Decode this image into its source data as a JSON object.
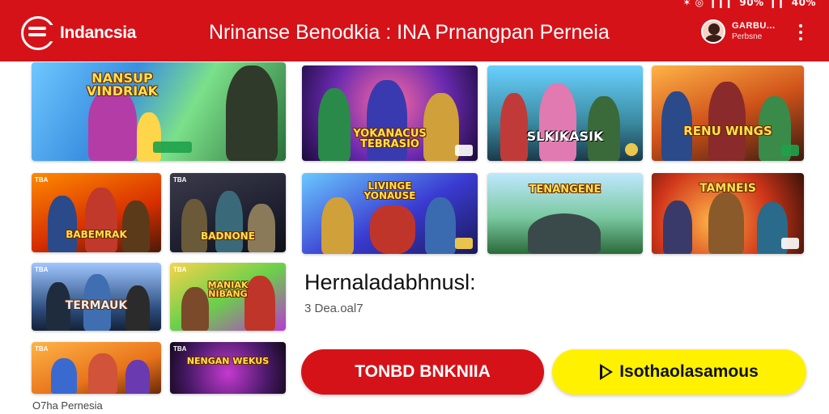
{
  "status_bar": {
    "icons": "✶ ◎",
    "signal": "▎▎▎ 90%",
    "battery": "▎▎ 40%"
  },
  "header": {
    "logo_text": "Indancsia",
    "title": "Nrinanse Benodkia : INA Prnangpan Perneia",
    "user_name": "GARBU...",
    "user_sub": "Perbsne"
  },
  "games": [
    {
      "caption": "NANSUP VINDRIAK",
      "tag": ""
    },
    {
      "caption": "YOKANACUS TEBRASIO",
      "tag": ""
    },
    {
      "caption": "SLKIKASIK",
      "tag": ""
    },
    {
      "caption": "RENU WINGS",
      "tag": ""
    },
    {
      "caption": "BABEMRAK",
      "tag": "TBA"
    },
    {
      "caption": "BADNONE",
      "tag": "TBA"
    },
    {
      "caption": "LIVINGE YONAUSE",
      "tag": ""
    },
    {
      "caption": "TENANGENE",
      "tag": ""
    },
    {
      "caption": "TAMNEIS",
      "tag": ""
    },
    {
      "caption": "TERMAUK",
      "tag": "TBA"
    },
    {
      "caption": "MANIAK NIBANG",
      "tag": "TBA"
    },
    {
      "caption": "",
      "tag": "TBA"
    },
    {
      "caption": "NENGAN WEKUS",
      "tag": "TBA"
    }
  ],
  "info": {
    "title": "Hernaladabhnusl:",
    "subtitle": "3 Dea.oal7"
  },
  "buttons": {
    "primary": "TONBD BNKNIIA",
    "secondary": "Isothaolasamous"
  },
  "footer": "O7ha Pernesia",
  "colors": {
    "brand_red": "#d61219",
    "accent_yellow": "#fff100"
  }
}
